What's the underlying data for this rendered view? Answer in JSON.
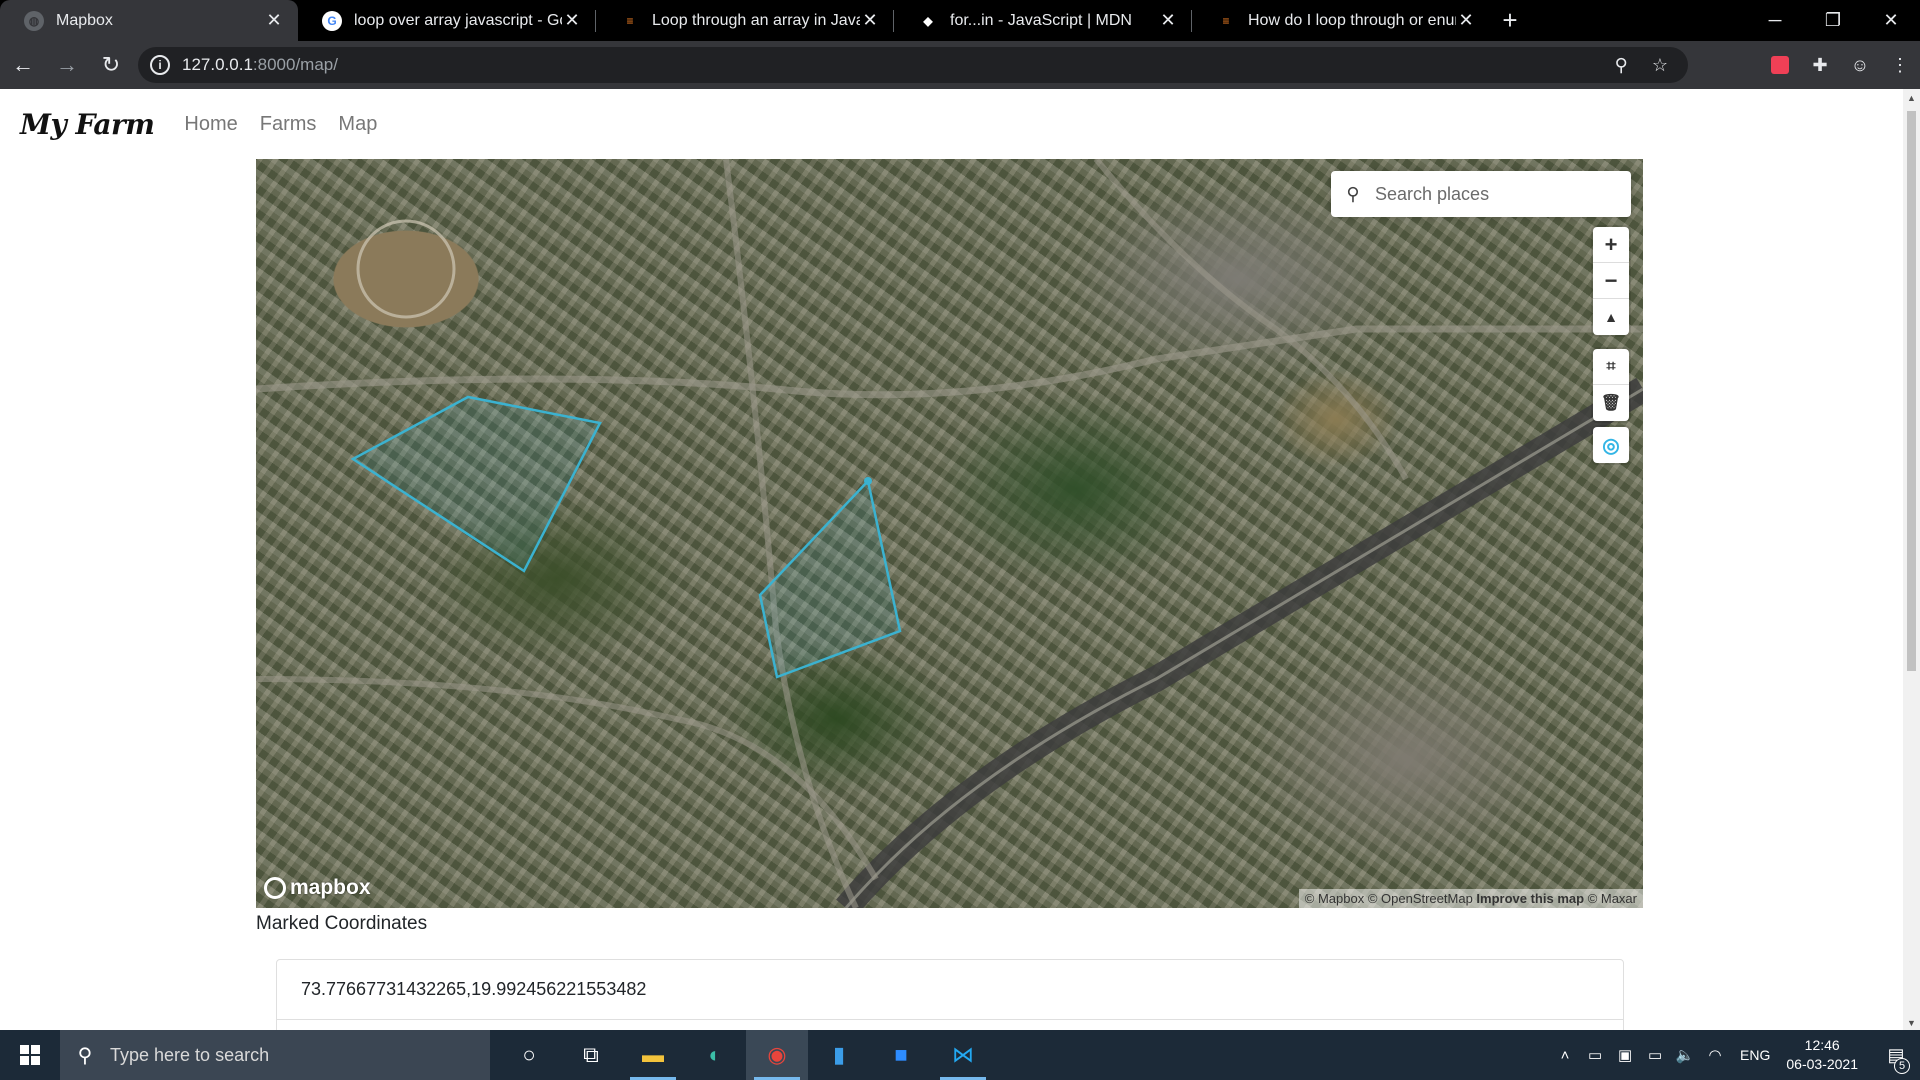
{
  "browser": {
    "tabs": [
      {
        "title": "Mapbox",
        "favicon": "globe-icon",
        "active": true
      },
      {
        "title": "loop over array javascript - Goog",
        "favicon": "google-icon",
        "active": false
      },
      {
        "title": "Loop through an array in JavaScr",
        "favicon": "stackoverflow-icon",
        "active": false
      },
      {
        "title": "for...in - JavaScript | MDN",
        "favicon": "mdn-icon",
        "active": false
      },
      {
        "title": "How do I loop through or enume",
        "favicon": "stackoverflow-icon",
        "active": false
      }
    ],
    "url_host": "127.0.0.1",
    "url_path": ":8000/map/"
  },
  "navbar": {
    "brand": "My Farm",
    "links": [
      "Home",
      "Farms",
      "Map"
    ]
  },
  "map": {
    "search_placeholder": "Search places",
    "logo_text": "mapbox",
    "attribution": {
      "mapbox": "© Mapbox",
      "osm": "© OpenStreetMap",
      "improve": "Improve this map",
      "maxar": "© Maxar"
    },
    "polygon_color": "#3bb2d0"
  },
  "coordinates": {
    "title": "Marked Coordinates",
    "items": [
      "73.77667731432265,19.992456221553482"
    ]
  },
  "taskbar": {
    "search_placeholder": "Type here to search",
    "language": "ENG",
    "time": "12:46",
    "date": "06-03-2021",
    "notification_count": "5"
  }
}
